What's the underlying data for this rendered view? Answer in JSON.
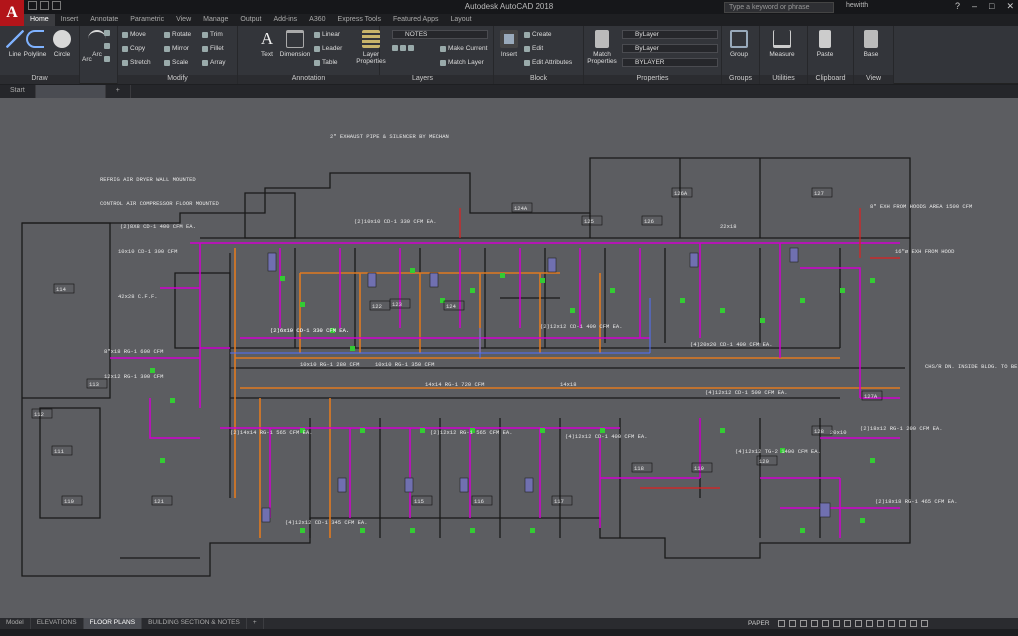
{
  "app": {
    "title": "Autodesk AutoCAD 2018",
    "logo_letter": "A",
    "search_placeholder": "Type a keyword or phrase",
    "user": "hewitth",
    "help": "?"
  },
  "ribbon_tabs": [
    "Home",
    "Insert",
    "Annotate",
    "Parametric",
    "View",
    "Manage",
    "Output",
    "Add-ins",
    "A360",
    "Express Tools",
    "Featured Apps",
    "Layout"
  ],
  "active_tab": "Home",
  "panels": {
    "draw": {
      "title": "Draw",
      "line": "Line",
      "polyline": "Polyline",
      "circle": "Circle",
      "arc": "Arc"
    },
    "modify": {
      "title": "Modify",
      "move": "Move",
      "rotate": "Rotate",
      "trim": "Trim",
      "copy": "Copy",
      "mirror": "Mirror",
      "fillet": "Fillet",
      "stretch": "Stretch",
      "scale": "Scale",
      "array": "Array"
    },
    "annotation": {
      "title": "Annotation",
      "text": "Text",
      "dimension": "Dimension",
      "linear": "Linear",
      "leader": "Leader",
      "table": "Table"
    },
    "layers": {
      "title": "Layers",
      "layer_properties": "Layer Properties",
      "current_layer": "NOTES",
      "make_current": "Make Current",
      "match_layer": "Match Layer"
    },
    "block": {
      "title": "Block",
      "insert": "Insert",
      "create": "Create",
      "edit": "Edit",
      "edit_attributes": "Edit Attributes"
    },
    "properties": {
      "title": "Properties",
      "match": "Match Properties",
      "color": "ByLayer",
      "linetype": "ByLayer",
      "lineweight": "BYLAYER"
    },
    "groups": {
      "title": "Groups",
      "group": "Group"
    },
    "utilities": {
      "title": "Utilities",
      "measure": "Measure"
    },
    "clipboard": {
      "title": "Clipboard",
      "paste": "Paste"
    },
    "view": {
      "title": "View",
      "base": "Base"
    }
  },
  "doc_tabs": [
    "Start",
    ""
  ],
  "layout_tabs": [
    "Model",
    "ELEVATIONS",
    "FLOOR PLANS",
    "BUILDING SECTION & NOTES"
  ],
  "active_layout": "FLOOR PLANS",
  "status": {
    "paper": "PAPER"
  },
  "colors": {
    "ribbon": "#33353a",
    "canvas": "#5c5d61",
    "duct": "#d000d0",
    "supply": "#e07a20",
    "green": "#33cc33",
    "walls": "#1a1a1a"
  },
  "drawing": {
    "notes": [
      "2\" EXHAUST PIPE & SILENCER BY MECHANICAL RUN EXHAUST UP THRU ROOF",
      "REFRIG AIR DRYER WALL MOUNTED",
      "CONTROL AIR COMPRESSOR FLOOR MOUNTED",
      "8\" EXH FROM HOODS AREA 1500 CFM",
      "16\"ø EXH FROM HOOD",
      "CHS/R DN. INSIDE BLDG. TO BELOW GRADE & STUB OUT & CAP FOR FUTURE CONNECTION HWS&R FROM (E) MC BLDG.",
      "(2)8X8 CD-1 400 CFM EA.",
      "10x10 CD-1 300 CFM",
      "42x28 C.F.F.",
      "8\"x18 RG-1 600 CFM",
      "12x12 RG-1 300 CFM",
      "(2)10x10 CD-1 330 CFM EA.",
      "(2)6x10 CD-1 330 CFM EA.",
      "10x10 RG-1 280 CFM",
      "10x10 RG-1 350 CFM",
      "(2)6x10 CD-1 330 CFM EA.",
      "14x14 RG-1 720 CFM",
      "(2)12x12 CD-1 400 CFM EA.",
      "(4)12x12 CD-1 400 CFM EA.",
      "(4)20x20 CD-1 400 CFM EA.",
      "(4)12x12 CD-1 500 CFM EA.",
      "(4)12x12 TG-2 1400 CFM EA.",
      "(2)14x14 RG-1 565 CFM EA.",
      "(2)12x12 RG-1 565 CFM EA.",
      "(4)12x12 CD-1 345 CFM EA.",
      "(2)18x12 RG-1 200 CFM EA.",
      "(2)18x18 RG-1 465 CFM EA.",
      "20x10",
      "14x18",
      "22x18"
    ],
    "room_tags": [
      "114",
      "113",
      "112",
      "111",
      "110",
      "121",
      "122",
      "123",
      "124",
      "124A",
      "125",
      "126",
      "126A",
      "127",
      "127A",
      "128",
      "120",
      "119",
      "118",
      "117",
      "116",
      "115"
    ],
    "small_tags": [
      "10\"ø",
      "12\"ø",
      "16\"ø",
      "18\"ø",
      "14\"ø",
      "20\"ø",
      "22\"ø",
      "8\"ø"
    ]
  }
}
